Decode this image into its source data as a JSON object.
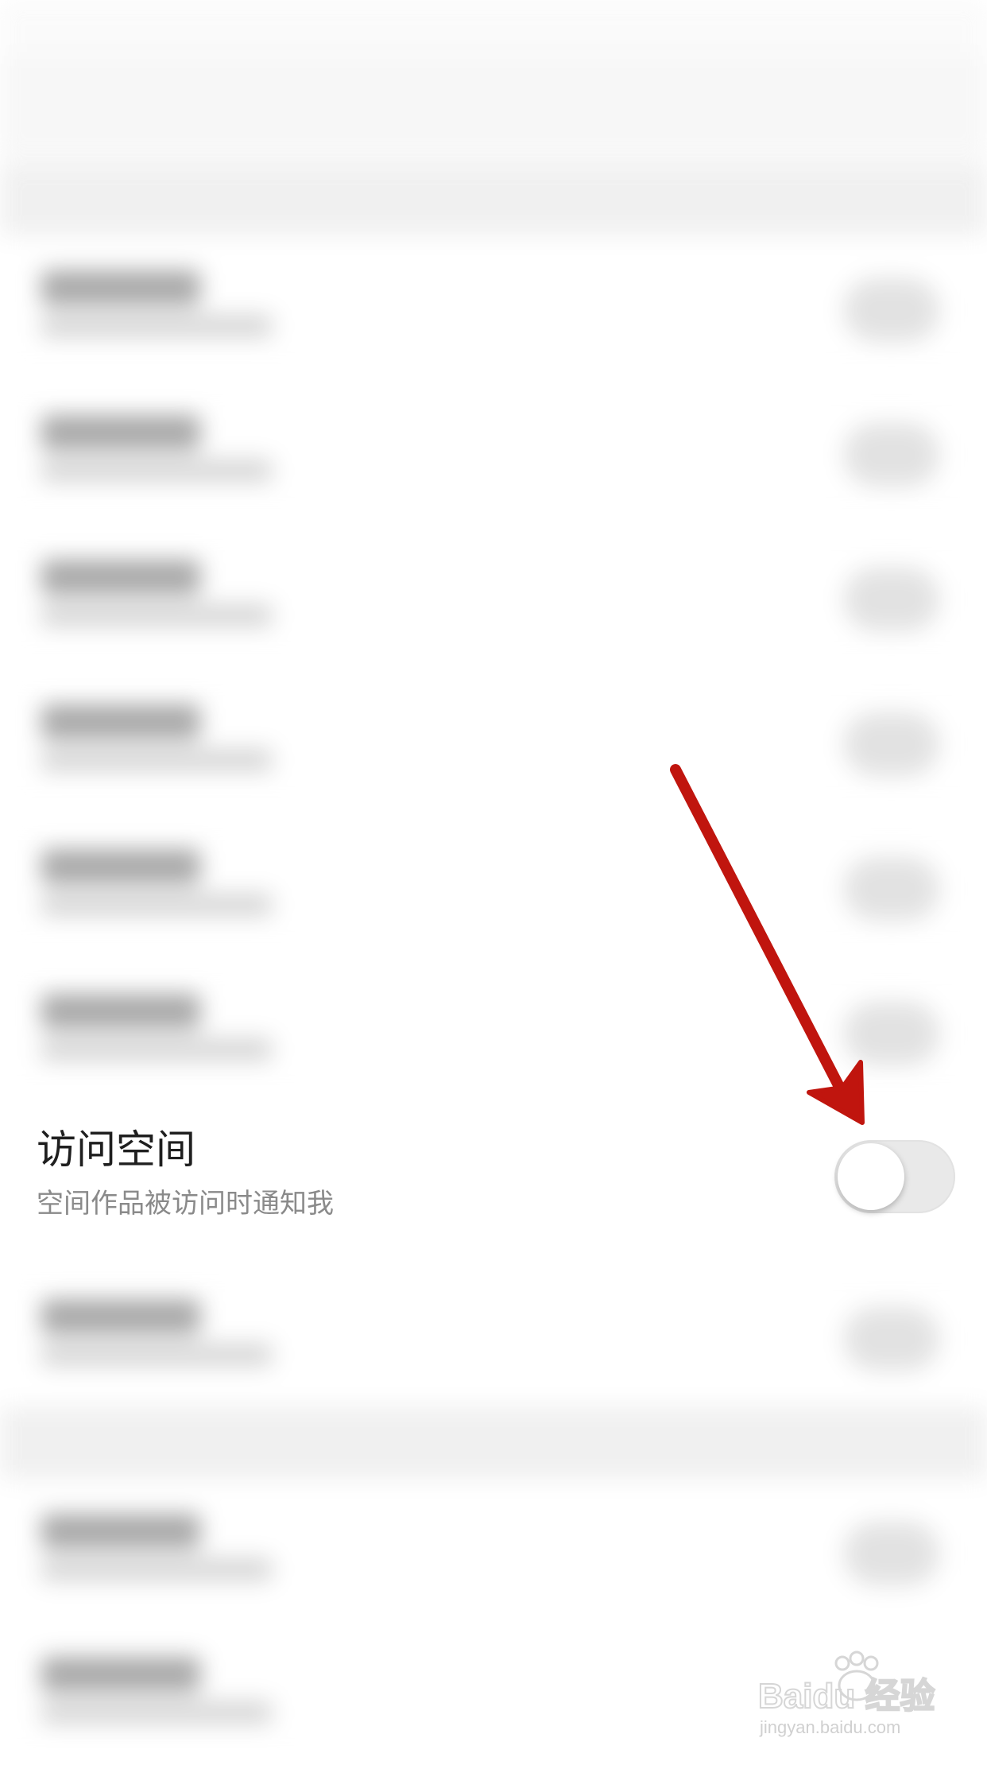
{
  "focus_item": {
    "title": "访问空间",
    "subtitle": "空间作品被访问时通知我",
    "toggle_on": false
  },
  "colors": {
    "arrow": "#c0150e",
    "toggle_off_bg": "#e9e9e9",
    "title_text": "#1f1f1f",
    "subtitle_text": "#8a8a8a"
  },
  "watermark": {
    "brand": "Baidu 经验",
    "url": "jingyan.baidu.com"
  },
  "icons": {
    "watermark": "baidu-paw-logo"
  }
}
